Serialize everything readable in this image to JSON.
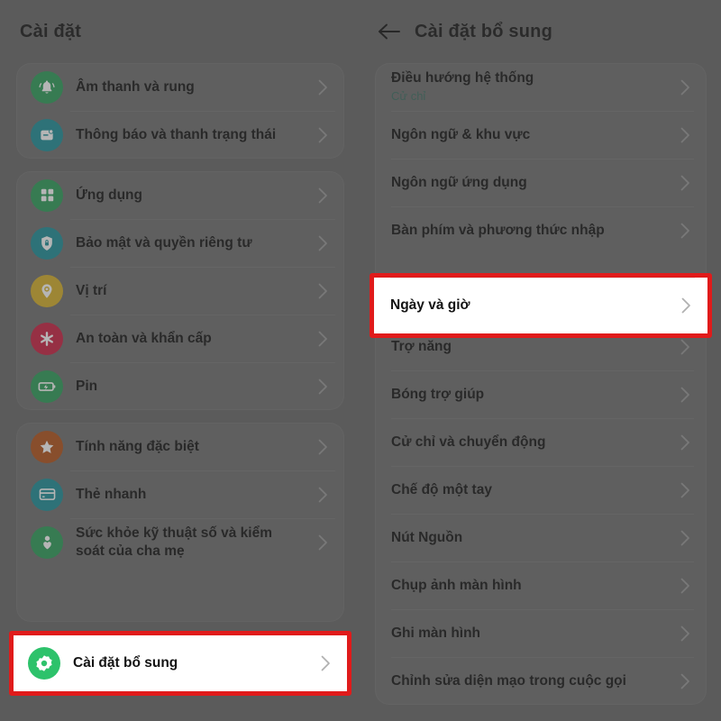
{
  "left_panel": {
    "title": "Cài đặt",
    "groups": [
      {
        "rows": [
          {
            "label": "Âm thanh và rung",
            "icon": "bell-icon",
            "icon_color": "#2e9e5b"
          },
          {
            "label": "Thông báo và thanh trạng thái",
            "icon": "notification-icon",
            "icon_color": "#1f9099"
          }
        ]
      },
      {
        "rows": [
          {
            "label": "Ứng dụng",
            "icon": "apps-grid-icon",
            "icon_color": "#2e9e5b"
          },
          {
            "label": "Bảo mật và quyền riêng tư",
            "icon": "shield-lock-icon",
            "icon_color": "#1f9099"
          },
          {
            "label": "Vị trí",
            "icon": "location-pin-icon",
            "icon_color": "#d8b12a"
          },
          {
            "label": "An toàn và khẩn cấp",
            "icon": "emergency-asterisk-icon",
            "icon_color": "#cc2244"
          },
          {
            "label": "Pin",
            "icon": "battery-icon",
            "icon_color": "#2e9e5b"
          }
        ]
      },
      {
        "rows": [
          {
            "label": "Tính năng đặc biệt",
            "icon": "star-icon",
            "icon_color": "#b4541c"
          },
          {
            "label": "Thẻ nhanh",
            "icon": "card-icon",
            "icon_color": "#1f9099"
          },
          {
            "label": "Sức khỏe kỹ thuật số và kiểm soát của cha mẹ",
            "icon": "person-heart-icon",
            "icon_color": "#2e9e5b"
          }
        ]
      }
    ],
    "highlighted_row": {
      "label": "Cài đặt bổ sung",
      "icon": "gear-icon",
      "icon_color": "#2dc26b"
    }
  },
  "right_panel": {
    "title": "Cài đặt bổ sung",
    "back_icon": "back-arrow-icon",
    "groups": [
      {
        "rows": [
          {
            "label": "Điều hướng hệ thống",
            "sub": "Cử chỉ"
          },
          {
            "label": "Ngôn ngữ & khu vực"
          },
          {
            "label": "Ngôn ngữ ứng dụng"
          },
          {
            "label": "Bàn phím và phương thức nhập"
          }
        ]
      },
      {
        "rows": [
          {
            "label": "Trợ năng"
          },
          {
            "label": "Bóng trợ giúp"
          },
          {
            "label": "Cử chỉ và chuyển động"
          },
          {
            "label": "Chế độ một tay"
          },
          {
            "label": "Nút Nguồn"
          },
          {
            "label": "Chụp ảnh màn hình"
          },
          {
            "label": "Ghi màn hình"
          },
          {
            "label": "Chỉnh sửa diện mạo trong cuộc gọi"
          }
        ]
      }
    ],
    "highlighted_row": {
      "label": "Ngày và giờ"
    }
  },
  "colors": {
    "highlight_border": "#e01b1b",
    "background": "#6a6a6a",
    "card": "#717171",
    "subtitle": "#3f6f63"
  }
}
